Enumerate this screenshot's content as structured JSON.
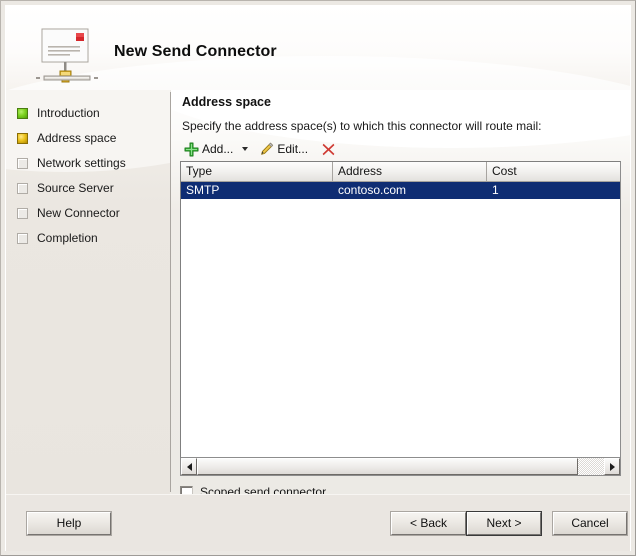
{
  "window": {
    "title": "New Send Connector",
    "icon": "mail-connector-icon"
  },
  "sidebar": {
    "steps": [
      {
        "label": "Introduction",
        "state": "done",
        "marker": "green-square-icon"
      },
      {
        "label": "Address space",
        "state": "current",
        "marker": "yellow-square-icon"
      },
      {
        "label": "Network settings",
        "state": "todo",
        "marker": "empty-square-icon"
      },
      {
        "label": "Source Server",
        "state": "todo",
        "marker": "empty-square-icon"
      },
      {
        "label": "New Connector",
        "state": "todo",
        "marker": "empty-square-icon"
      },
      {
        "label": "Completion",
        "state": "todo",
        "marker": "empty-square-icon"
      }
    ]
  },
  "content": {
    "section_title": "Address space",
    "instruction": "Specify the address space(s) to which this connector will route mail:",
    "toolbar": {
      "add_label": "Add...",
      "add_icon": "green-plus-icon",
      "add_dropdown_icon": "chevron-down-icon",
      "edit_label": "Edit...",
      "edit_icon": "pencil-icon",
      "delete_icon": "red-x-icon"
    },
    "table": {
      "columns": [
        "Type",
        "Address",
        "Cost"
      ],
      "rows": [
        {
          "type": "SMTP",
          "address": "contoso.com",
          "cost": "1",
          "selected": true
        }
      ],
      "selection_color": "#0f2d73"
    },
    "scrollbar": {
      "left_arrow_icon": "arrow-left-icon",
      "right_arrow_icon": "arrow-right-icon"
    },
    "checkbox": {
      "label": "Scoped send connector",
      "checked": false
    }
  },
  "footer": {
    "help_label": "Help",
    "back_label": "< Back",
    "next_label": "Next >",
    "cancel_label": "Cancel"
  }
}
